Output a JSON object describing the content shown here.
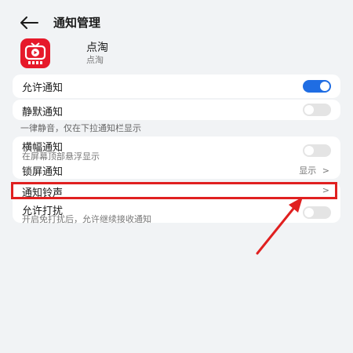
{
  "header": {
    "title": "通知管理"
  },
  "app": {
    "name": "点淘",
    "subtitle": "点淘"
  },
  "settings": {
    "allow": {
      "label": "允许通知",
      "enabled": true
    },
    "silent": {
      "label": "静默通知",
      "enabled": false,
      "hint": "一律静音，仅在下拉通知栏显示"
    },
    "banner": {
      "label": "横幅通知",
      "sub": "在屏幕顶部悬浮显示",
      "enabled": false
    },
    "lockscreen": {
      "label": "锁屏通知",
      "value": "显示"
    },
    "ringtone": {
      "label": "通知铃声"
    },
    "dnd": {
      "label": "允许打扰",
      "sub": "开启免打扰后，允许继续接收通知",
      "enabled": false
    }
  },
  "glyphs": {
    "chevron": ">"
  },
  "colors": {
    "accent": "#1f6de3",
    "annotation": "#e02020",
    "app_icon": "#e6192a"
  }
}
